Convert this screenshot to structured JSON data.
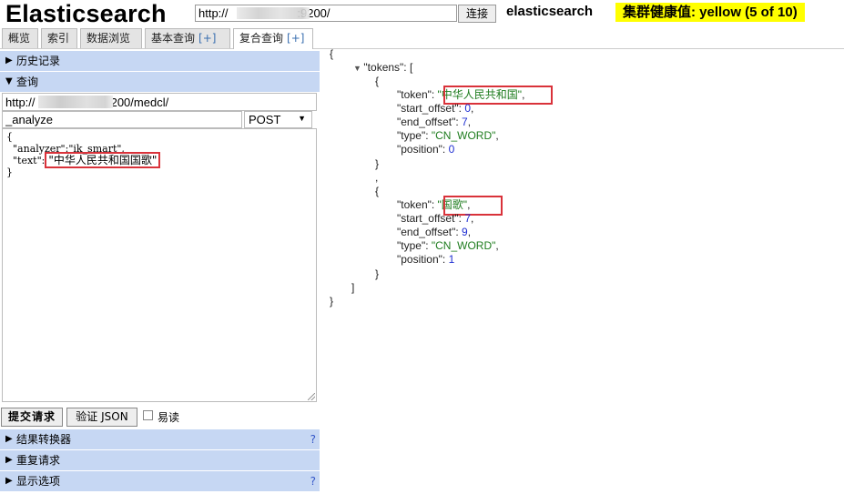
{
  "header": {
    "app_title": "Elasticsearch",
    "url_value": "http://                     :9200/",
    "connect_label": "连接",
    "cluster_name": "elasticsearch",
    "cluster_health": "集群健康值: yellow (5 of 10)",
    "health_color": "#ffff00"
  },
  "tabs": [
    {
      "label": "概览"
    },
    {
      "label": "索引"
    },
    {
      "label": "数据浏览"
    },
    {
      "label": "基本查询",
      "plus": "[+]"
    },
    {
      "label": "复合查询",
      "plus": "[+]",
      "active": true
    }
  ],
  "left": {
    "history_label": "历史记录",
    "query_label": "查询",
    "request_url": "http://                    :9200/medcl/",
    "request_path": "_analyze",
    "method": "POST",
    "body_lines": [
      "{",
      "  \"analyzer\":\"ik_smart\",",
      "  \"text\":"
    ],
    "body_text_value": "\"中华人民共和国国歌\"",
    "body_close": "}",
    "submit_label": "提交请求",
    "validate_label": "验证 JSON",
    "readonly_label": "易读",
    "result_transformer_label": "结果转换器",
    "repeat_request_label": "重复请求",
    "display_options_label": "显示选项",
    "help_mark": "?"
  },
  "response": {
    "open_brace": "{",
    "tokens_key": "\"tokens\"",
    "tokens_open": ": [",
    "items": [
      {
        "token": "\"中华人民共和国\"",
        "start_offset": "0",
        "end_offset": "7",
        "type": "\"CN_WORD\"",
        "position": "0"
      },
      {
        "token": "\"国歌\"",
        "start_offset": "7",
        "end_offset": "9",
        "type": "\"CN_WORD\"",
        "position": "1"
      }
    ],
    "labels": {
      "token": "\"token\": ",
      "start_offset": "\"start_offset\": ",
      "end_offset": "\"end_offset\": ",
      "type": "\"type\": ",
      "position": "\"position\": "
    },
    "comma": ",",
    "obj_open": "{",
    "obj_close": "}",
    "array_close": "]",
    "close_brace": "}"
  }
}
